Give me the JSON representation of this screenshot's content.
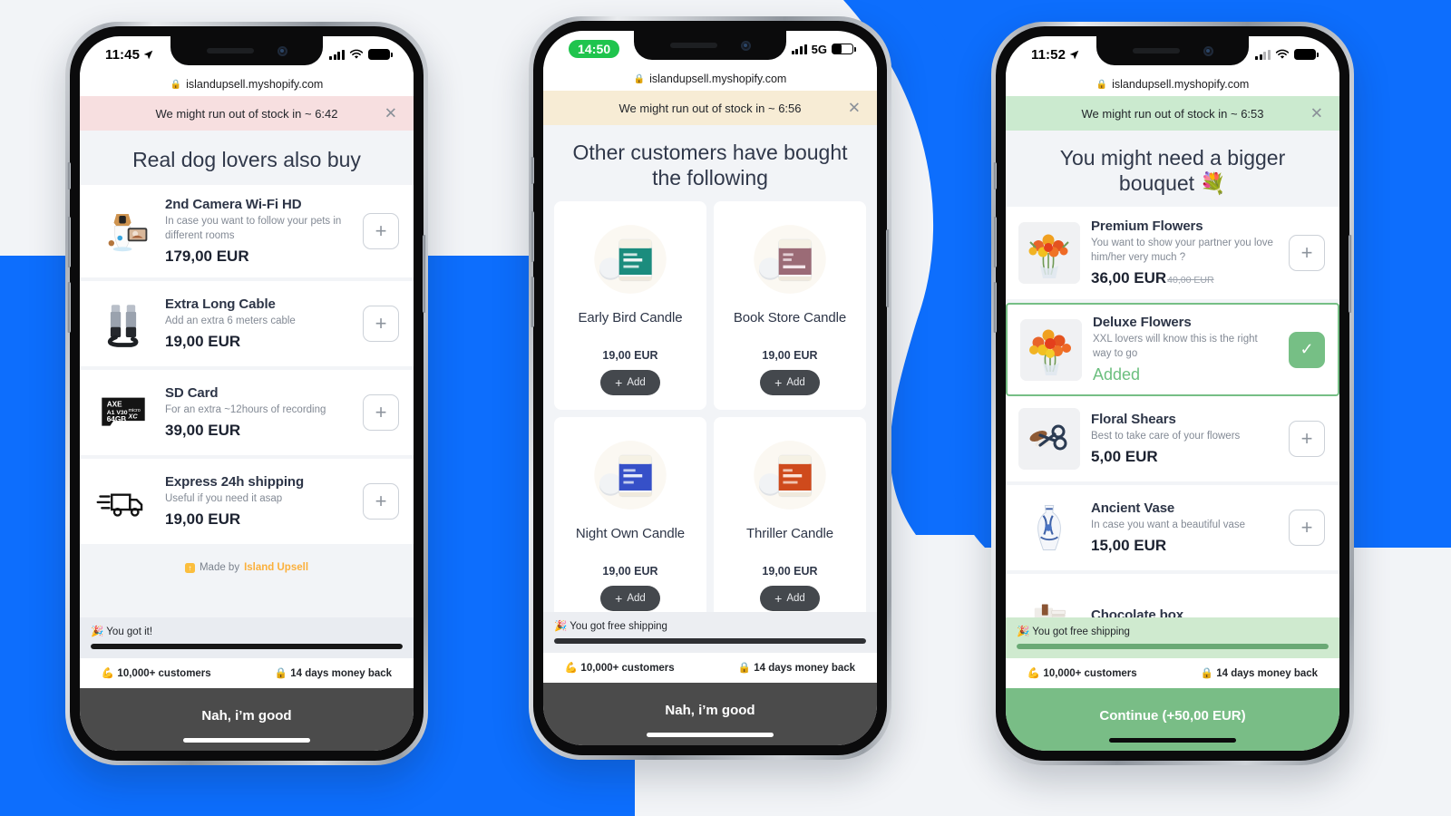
{
  "background": {
    "blue": "#0d6efd",
    "light": "#f2f4f7"
  },
  "phones": [
    {
      "id": "phone-left",
      "status": {
        "time": "11:45",
        "time_style": "plain",
        "network": "",
        "location_icon": "location-arrow-icon",
        "wifi_icon": "wifi-icon",
        "battery": "full"
      },
      "url": "islandupsell.myshopify.com",
      "banner": {
        "text": "We might run out of stock in ~ 6:42",
        "bg": "#f7dfe0",
        "close_icon": "close-icon"
      },
      "heading": "Real dog lovers also buy",
      "layout": "list",
      "items": [
        {
          "title": "2nd Camera Wi-Fi HD",
          "desc": "In case you want to follow your pets in different rooms",
          "price": "179,00 EUR",
          "compare_at": "",
          "action": "add",
          "action_label": "+",
          "icon": "pet-camera-image",
          "selected": false
        },
        {
          "title": "Extra Long Cable",
          "desc": "Add an extra 6 meters cable",
          "price": "19,00 EUR",
          "compare_at": "",
          "action": "add",
          "action_label": "+",
          "icon": "usb-cable-image",
          "selected": false
        },
        {
          "title": "SD Card",
          "desc": "For an extra ~12hours of recording",
          "price": "39,00 EUR",
          "compare_at": "",
          "action": "add",
          "action_label": "+",
          "icon": "sd-card-image",
          "selected": false
        },
        {
          "title": "Express 24h shipping",
          "desc": "Useful if you need it asap",
          "price": "19,00 EUR",
          "compare_at": "",
          "action": "add",
          "action_label": "+",
          "icon": "delivery-truck-icon",
          "selected": false
        }
      ],
      "made_by": {
        "prefix": "Made by",
        "brand": "Island Upsell",
        "badge_icon": "island-upsell-logo"
      },
      "progress": {
        "label": "🎉 You got it!",
        "percent": 100,
        "bar_color": "#171717",
        "strip_bg": "#e9ecf1"
      },
      "badges": [
        "💪 10,000+ customers",
        "🔒 14 days money back"
      ],
      "cta": {
        "label": "Nah, i’m good",
        "style": "dark"
      }
    },
    {
      "id": "phone-center",
      "status": {
        "time": "14:50",
        "time_style": "pill",
        "network": "5G",
        "location_icon": "",
        "wifi_icon": "",
        "battery": "half"
      },
      "url": "islandupsell.myshopify.com",
      "banner": {
        "text": "We might run out of stock in ~ 6:56",
        "bg": "#f7ecd5",
        "close_icon": "close-icon"
      },
      "heading": "Other customers have bought the following",
      "layout": "grid",
      "items": [
        {
          "title": "Early Bird Candle",
          "price": "19,00 EUR",
          "add_label": "Add",
          "icon": "candle-teal-image"
        },
        {
          "title": "Book Store Candle",
          "price": "19,00 EUR",
          "add_label": "Add",
          "icon": "candle-mauve-image"
        },
        {
          "title": "Night Own Candle",
          "price": "19,00 EUR",
          "add_label": "Add",
          "icon": "candle-blue-image"
        },
        {
          "title": "Thriller Candle",
          "price": "19,00 EUR",
          "add_label": "Add",
          "icon": "candle-orange-image"
        }
      ],
      "progress": {
        "label": "🎉 You got free shipping",
        "percent": 100,
        "bar_color": "#2f3034",
        "strip_bg": "#eceef2"
      },
      "badges": [
        "💪 10,000+ customers",
        "🔒 14 days money back"
      ],
      "cta": {
        "label": "Nah, i’m good",
        "style": "dark"
      }
    },
    {
      "id": "phone-right",
      "status": {
        "time": "11:52",
        "time_style": "plain",
        "network": "",
        "location_icon": "location-arrow-icon",
        "wifi_icon": "wifi-icon",
        "battery": "full"
      },
      "url": "islandupsell.myshopify.com",
      "banner": {
        "text": "We might run out of stock in ~ 6:53",
        "bg": "#cbeacf",
        "close_icon": "close-icon"
      },
      "heading": "You might need a bigger bouquet 💐",
      "layout": "list",
      "items": [
        {
          "title": "Premium Flowers",
          "desc": "You want to show your partner you love him/her very much ?",
          "price": "36,00 EUR",
          "compare_at": "40,00 EUR",
          "action": "add",
          "action_label": "+",
          "icon": "bouquet-premium-image",
          "selected": false
        },
        {
          "title": "Deluxe Flowers",
          "desc": "XXL lovers will know this is the right way to go",
          "price": "Added",
          "compare_at": "",
          "action": "added",
          "action_label": "✓",
          "icon": "bouquet-deluxe-image",
          "selected": true
        },
        {
          "title": "Floral Shears",
          "desc": "Best to take care of your flowers",
          "price": "5,00 EUR",
          "compare_at": "",
          "action": "add",
          "action_label": "+",
          "icon": "floral-shears-image",
          "selected": false
        },
        {
          "title": "Ancient Vase",
          "desc": "In case you want a beautiful vase",
          "price": "15,00 EUR",
          "compare_at": "",
          "action": "add",
          "action_label": "+",
          "icon": "ancient-vase-image",
          "selected": false
        },
        {
          "title": "Chocolate box",
          "desc": "",
          "price": "",
          "compare_at": "",
          "action": "add",
          "action_label": "+",
          "icon": "chocolate-box-image",
          "selected": false
        }
      ],
      "progress": {
        "label": "🎉 You got free shipping",
        "percent": 100,
        "bar_color": "#6aa975",
        "strip_bg": "#cfeacf"
      },
      "badges": [
        "💪 10,000+ customers",
        "🔒 14 days money back"
      ],
      "cta": {
        "label": "Continue (+50,00 EUR)",
        "style": "green"
      }
    }
  ]
}
